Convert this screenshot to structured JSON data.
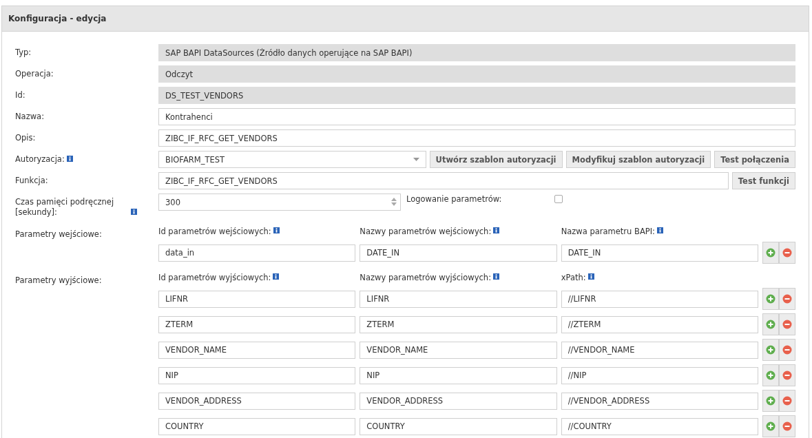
{
  "panel": {
    "title": "Konfiguracja - edycja"
  },
  "readonly_fields": [
    {
      "label": "Typ:",
      "value": "SAP BAPI DataSources (Źródło danych operujące na SAP BAPI)"
    },
    {
      "label": "Operacja:",
      "value": "Odczyt"
    },
    {
      "label": "Id:",
      "value": "DS_TEST_VENDORS"
    }
  ],
  "text_fields": [
    {
      "label": "Nazwa:",
      "value": "Kontrahenci"
    },
    {
      "label": "Opis:",
      "value": "ZIBC_IF_RFC_GET_VENDORS"
    }
  ],
  "authorization": {
    "label": "Autoryzacja:",
    "value": "BIOFARM_TEST",
    "buttons": [
      "Utwórz szablon autoryzacji",
      "Modyfikuj szablon autoryzacji",
      "Test połączenia"
    ]
  },
  "function": {
    "label": "Funkcja:",
    "value": "ZIBC_IF_RFC_GET_VENDORS",
    "button": "Test funkcji"
  },
  "cache": {
    "label": "Czas pamięci podręcznej [sekundy]:",
    "value": "300",
    "logging_label": "Logowanie parametrów:",
    "logging_checked": false
  },
  "input_params": {
    "label": "Parametry wejściowe:",
    "columns": [
      "Id parametrów wejściowych:",
      "Nazwy parametrów wejściowych:",
      "Nazwa parametru BAPI:"
    ],
    "rows": [
      [
        "data_in",
        "DATE_IN",
        "DATE_IN"
      ]
    ]
  },
  "output_params": {
    "label": "Parametry wyjściowe:",
    "columns": [
      "Id parametrów wyjściowych:",
      "Nazwy parametrów wyjściowych:",
      "xPath:"
    ],
    "rows": [
      [
        "LIFNR",
        "LIFNR",
        "//LIFNR"
      ],
      [
        "ZTERM",
        "ZTERM",
        "//ZTERM"
      ],
      [
        "VENDOR_NAME",
        "VENDOR_NAME",
        "//VENDOR_NAME"
      ],
      [
        "NIP",
        "NIP",
        "//NIP"
      ],
      [
        "VENDOR_ADDRESS",
        "VENDOR_ADDRESS",
        "//VENDOR_ADDRESS"
      ],
      [
        "COUNTRY",
        "COUNTRY",
        "//COUNTRY"
      ]
    ]
  }
}
